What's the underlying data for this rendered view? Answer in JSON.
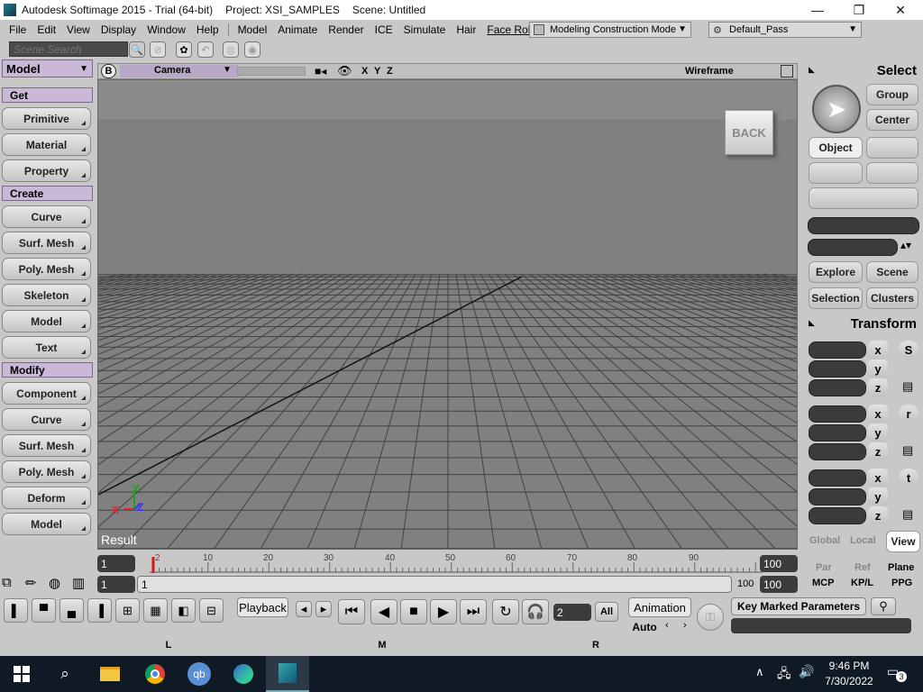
{
  "window": {
    "app_title": "Autodesk Softimage 2015 - Trial (64-bit)",
    "project": "Project: XSI_SAMPLES",
    "scene": "Scene: Untitled",
    "minimize": "—",
    "maximize": "❐",
    "close": "✕"
  },
  "menubar": {
    "items": [
      "File",
      "Edit",
      "View",
      "Display",
      "Window",
      "Help",
      "Model",
      "Animate",
      "Render",
      "ICE",
      "Simulate",
      "Hair",
      "Face Robot"
    ],
    "mode_dropdown": "Modeling Construction Mode",
    "pass_dropdown": "Default_Pass"
  },
  "search": {
    "placeholder": "Scene Search"
  },
  "left_panel": {
    "title": "Model",
    "get_label": "Get",
    "get_items": [
      "Primitive",
      "Material",
      "Property"
    ],
    "create_label": "Create",
    "create_items": [
      "Curve",
      "Surf. Mesh",
      "Poly. Mesh",
      "Skeleton",
      "Model",
      "Text"
    ],
    "modify_label": "Modify",
    "modify_items": [
      "Component",
      "Curve",
      "Surf. Mesh",
      "Poly. Mesh",
      "Deform",
      "Model"
    ]
  },
  "viewport": {
    "b_label": "B",
    "camera": "Camera",
    "x": "X",
    "y": "Y",
    "z": "Z",
    "display_mode": "Wireframe",
    "cube_face": "BACK",
    "result_label": "Result",
    "axis_x": "X",
    "axis_y": "Y",
    "axis_z": "Z"
  },
  "right_panel": {
    "select_title": "Select",
    "group": "Group",
    "center": "Center",
    "object": "Object",
    "explore": "Explore",
    "scene": "Scene",
    "selection": "Selection",
    "clusters": "Clusters",
    "transform_title": "Transform",
    "s_label": "S",
    "r_label": "r",
    "t_label": "t",
    "x": "x",
    "y": "y",
    "z": "z",
    "global": "Global",
    "local": "Local",
    "view": "View",
    "par": "Par",
    "ref": "Ref",
    "plane": "Plane",
    "mcp": "MCP",
    "kpl": "KP/L",
    "ppg": "PPG"
  },
  "timeline": {
    "start_frame": "1",
    "end_frame": "100",
    "ticks": [
      "10",
      "20",
      "30",
      "40",
      "50",
      "60",
      "70",
      "80",
      "90"
    ],
    "current_marker": "2",
    "range_start": "1",
    "range_start_label": "1",
    "range_end_label": "100",
    "range_end": "100"
  },
  "bottom": {
    "playback": "Playback",
    "current_frame": "2",
    "all": "All",
    "animation": "Animation",
    "auto": "Auto",
    "key_marked": "Key Marked Parameters",
    "tab_l": "L",
    "tab_m": "M",
    "tab_r": "R"
  },
  "taskbar": {
    "time": "9:46 PM",
    "date": "7/30/2022",
    "notif_count": "3",
    "qb": "qb"
  },
  "colors": {
    "panel_bg": "#c8c8c8",
    "section_header": "#c9b8d6",
    "viewport_bg": "#808080",
    "timeline_marker": "#d11a1a"
  }
}
